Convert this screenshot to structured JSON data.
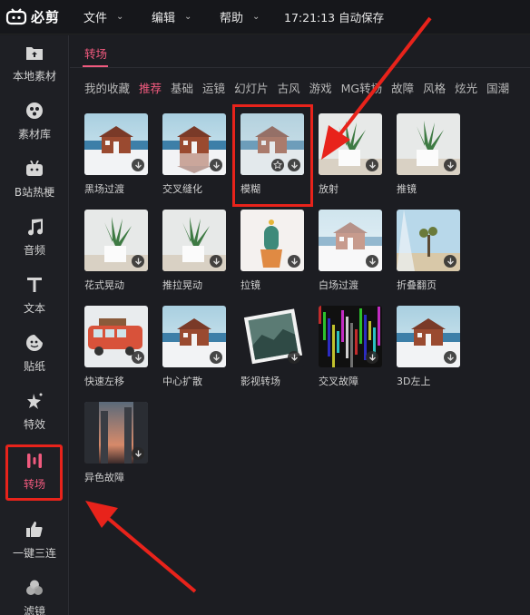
{
  "app": {
    "logo_text": "必剪",
    "menus": [
      {
        "label": "文件",
        "icon": "chevron-down-icon"
      },
      {
        "label": "编辑",
        "icon": "chevron-down-icon"
      },
      {
        "label": "帮助",
        "icon": "chevron-down-icon"
      }
    ],
    "status": "17:21:13 自动保存"
  },
  "sidebar": {
    "items": [
      {
        "label": "本地素材",
        "icon": "folder-upload-icon"
      },
      {
        "label": "素材库",
        "icon": "material-library-icon"
      },
      {
        "label": "B站热梗",
        "icon": "bilibili-tv-icon"
      },
      {
        "label": "音频",
        "icon": "music-note-icon"
      },
      {
        "label": "文本",
        "icon": "text-t-icon"
      },
      {
        "label": "贴纸",
        "icon": "sticker-icon"
      },
      {
        "label": "特效",
        "icon": "sparkle-star-icon"
      },
      {
        "label": "转场",
        "icon": "transition-icon",
        "active": true
      },
      {
        "label": "一键三连",
        "icon": "thumbs-up-icon"
      },
      {
        "label": "滤镜",
        "icon": "filter-circles-icon"
      }
    ]
  },
  "panel": {
    "title": "转场",
    "categories": [
      "我的收藏",
      "推荐",
      "基础",
      "运镜",
      "幻灯片",
      "古风",
      "游戏",
      "MG转场",
      "故障",
      "风格",
      "炫光",
      "国潮"
    ],
    "active_category": "推荐",
    "transitions": [
      {
        "name": "黑场过渡",
        "thumb": "house"
      },
      {
        "name": "交叉缝化",
        "thumb": "house-mirror"
      },
      {
        "name": "模糊",
        "thumb": "house-blur",
        "highlighted": true,
        "show_favorite": true
      },
      {
        "name": "放射",
        "thumb": "plant"
      },
      {
        "name": "推镜",
        "thumb": "plant"
      },
      {
        "name": "花式晃动",
        "thumb": "plant"
      },
      {
        "name": "推拉晃动",
        "thumb": "plant"
      },
      {
        "name": "拉镜",
        "thumb": "cactus"
      },
      {
        "name": "白场过渡",
        "thumb": "house-faded"
      },
      {
        "name": "折叠翻页",
        "thumb": "desert"
      },
      {
        "name": "快速左移",
        "thumb": "bus"
      },
      {
        "name": "中心扩散",
        "thumb": "house"
      },
      {
        "name": "影视转场",
        "thumb": "photo-hills"
      },
      {
        "name": "交叉故障",
        "thumb": "glitch"
      },
      {
        "name": "3D左上",
        "thumb": "house"
      },
      {
        "name": "异色故障",
        "thumb": "city"
      }
    ]
  },
  "colors": {
    "accent": "#f05a7e",
    "annotation_red": "#e8231b"
  }
}
